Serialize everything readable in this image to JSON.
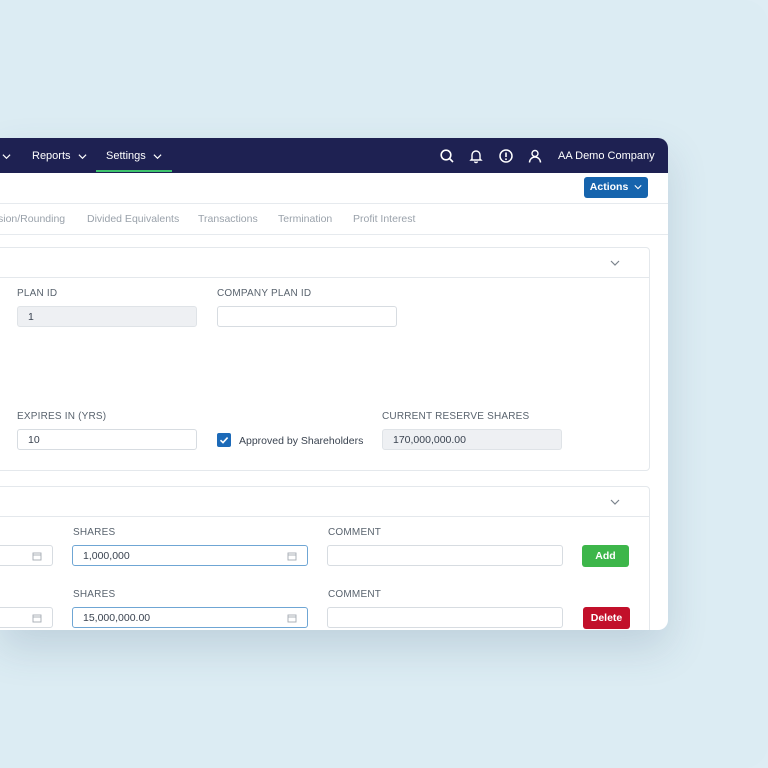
{
  "nav": {
    "items": [
      {
        "label": "Reports"
      },
      {
        "label": "Settings"
      }
    ],
    "company": "AA Demo Company"
  },
  "actionbar": {
    "actions_label": "Actions"
  },
  "tabs": [
    "sion/Rounding",
    "Divided Equivalents",
    "Transactions",
    "Termination",
    "Profit Interest"
  ],
  "plan_panel": {
    "plan_id_label": "PLAN ID",
    "plan_id_value": "1",
    "company_plan_id_label": "COMPANY PLAN ID",
    "company_plan_id_value": "",
    "expires_label": "EXPIRES IN (YRS)",
    "expires_value": "10",
    "approved_label": "Approved by Shareholders",
    "approved_checked": true,
    "reserve_label": "CURRENT RESERVE SHARES",
    "reserve_value": "170,000,000.00"
  },
  "shares_panel": {
    "rows": [
      {
        "shares_label": "SHARES",
        "shares_value": "1,000,000",
        "comment_label": "COMMENT",
        "comment_value": "",
        "button_label": "Add"
      },
      {
        "shares_label": "SHARES",
        "shares_value": "15,000,000.00",
        "comment_label": "COMMENT",
        "comment_value": "",
        "button_label": "Delete"
      }
    ]
  },
  "colors": {
    "nav_bg": "#1e2152",
    "accent_green": "#3ec46d",
    "actions_blue": "#1664ad",
    "add_green": "#3db64a",
    "delete_red": "#c2102a"
  }
}
